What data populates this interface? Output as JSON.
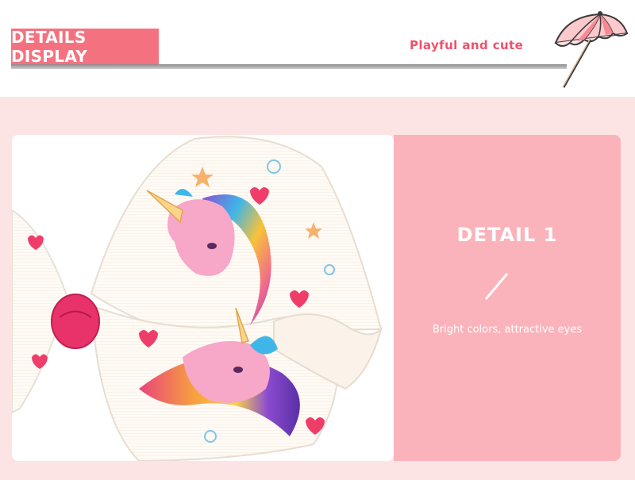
{
  "header": {
    "title": "DETAILS DISPLAY",
    "tagline": "Playful and cute"
  },
  "detail": {
    "title": "DETAIL 1",
    "description": "Bright colors, attractive eyes"
  },
  "icons": {
    "umbrella": "umbrella-icon",
    "product_photo": "unicorn-hair-bow-photo"
  },
  "colors": {
    "accent": "#f4727f",
    "tagline": "#f0506a",
    "content_background": "#fde4e4",
    "info_panel": "#fbb3bb",
    "bow_knot": "#e8326a"
  }
}
